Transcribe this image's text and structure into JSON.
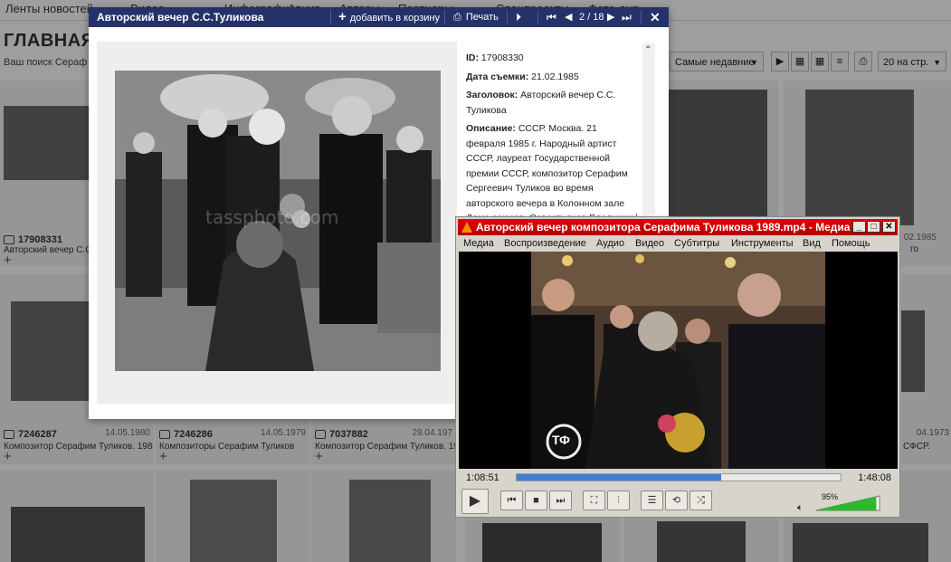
{
  "site": {
    "nav": [
      "Ленты новостей",
      "Видео",
      "Инфографика",
      "Архив",
      "Авторы",
      "Партнеры",
      "Спецпроекты",
      "Фото дня"
    ],
    "title": "ГЛАВНАЯ",
    "search_text": "Ваш поиск Сераф",
    "sort_label": "Самые недавние",
    "per_page_label": "20 на стр.",
    "cards": [
      {
        "id": "17908331",
        "date": "",
        "caption": "Авторский вечер С.С.Т"
      },
      {
        "id": "",
        "date": "",
        "caption": ""
      },
      {
        "id": "",
        "date": "",
        "caption": ""
      },
      {
        "id": "",
        "date": "",
        "caption": ""
      },
      {
        "id": "",
        "date": "",
        "caption": ""
      },
      {
        "id": "",
        "date": "02.1985",
        "caption": "го"
      },
      {
        "id": "7246287",
        "date": "14.05.1980",
        "caption": "Композитор Серафим Туликов. 1980"
      },
      {
        "id": "7246286",
        "date": "14.05.1979",
        "caption": "Композиторы Серафим Туликов и"
      },
      {
        "id": "7037882",
        "date": "29.04.197",
        "caption": "Композитор Серафим Туликов. 1974"
      },
      {
        "id": "",
        "date": "",
        "caption": ""
      },
      {
        "id": "",
        "date": "",
        "caption": ""
      },
      {
        "id": "",
        "date": "04.1973",
        "caption": "СФСР."
      }
    ]
  },
  "photo_modal": {
    "title": "Авторский вечер С.С.Туликова",
    "add_to_cart": "добавить в корзину",
    "print": "Печать",
    "counter": "2 / 18",
    "watermark": "tassphoto.com",
    "meta": {
      "id_label": "ID:",
      "id_value": "17908330",
      "date_label": "Дата съемки:",
      "date_value": "21.02.1985",
      "headline_label": "Заголовок:",
      "headline_value": "Авторский вечер С.С. Туликова",
      "desc_label": "Описание:",
      "desc_value": "СССР. Москва. 21 февраля 1985 г. Народный артист СССР, лауреат Государственной премии СССР, композитор Серафим Сергеевич Туликов во время авторского вечера в Колонном зале Дома союзов. Савостьянов Владимир/Фотохроника ТАСС"
    }
  },
  "vlc": {
    "title": "Авторский вечер композитора Серафима Туликова 1989.mp4 - Медиаплеер VLC",
    "menu": [
      "Медиа",
      "Воспроизведение",
      "Аудио",
      "Видео",
      "Субтитры",
      "Инструменты",
      "Вид",
      "Помощь"
    ],
    "time_current": "1:08:51",
    "time_total": "1:48:08",
    "progress": 0.63,
    "volume_label": "95%",
    "volume": 0.95,
    "logo_text": "ТФ",
    "colors": {
      "title_bar": "#d00000",
      "progress": "#3d7fd0",
      "volume": "#2db82d"
    }
  }
}
